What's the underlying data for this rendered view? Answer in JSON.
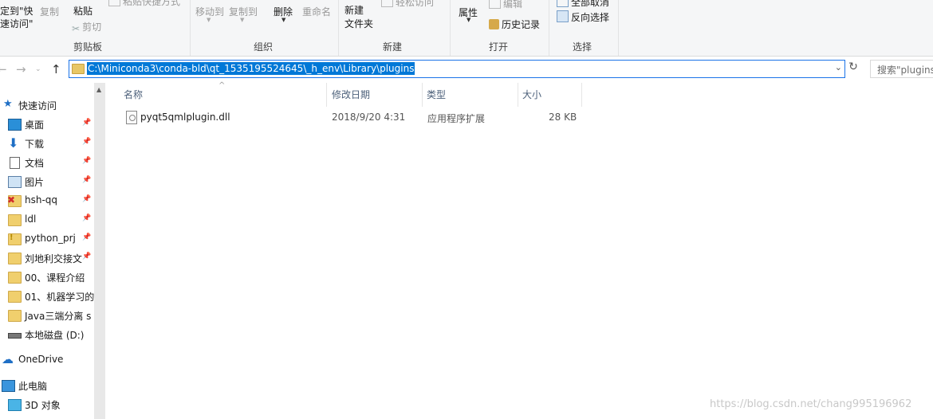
{
  "ribbon": {
    "clipboard": {
      "pin_to_quick_access": "定到\"快\n速访问\"",
      "copy": "复制",
      "paste": "粘贴",
      "cut": "剪切",
      "copy_path_partial": "粘贴快捷方式",
      "group_label": "剪贴板"
    },
    "organize": {
      "move_to": "移动到",
      "copy_to": "复制到",
      "delete": "删除",
      "rename": "重命名",
      "group_label": "组织"
    },
    "new": {
      "new_folder": "新建\n文件夹",
      "easy_access": "轻松访问",
      "group_label": "新建"
    },
    "open": {
      "properties": "属性",
      "edit": "编辑",
      "history": "历史记录",
      "group_label": "打开"
    },
    "select": {
      "select_none_partial": "全部取消",
      "invert_selection": "反向选择",
      "group_label": "选择"
    }
  },
  "address": {
    "path": "C:\\Miniconda3\\conda-bld\\qt_1535195524645\\_h_env\\Library\\plugins",
    "search_placeholder": "搜索\"plugins\""
  },
  "sidebar": {
    "quick_access": "快速访问",
    "items": [
      {
        "label": "桌面",
        "icon": "desktop-icon",
        "pinned": true
      },
      {
        "label": "下载",
        "icon": "download-icon",
        "pinned": true
      },
      {
        "label": "文档",
        "icon": "document-icon",
        "pinned": true
      },
      {
        "label": "图片",
        "icon": "picture-icon",
        "pinned": true
      },
      {
        "label": "hsh-qq",
        "icon": "folder-error-icon",
        "pinned": true
      },
      {
        "label": "ldl",
        "icon": "folder-icon",
        "pinned": true
      },
      {
        "label": "python_prj",
        "icon": "folder-warning-icon",
        "pinned": true
      },
      {
        "label": "刘地利交接文",
        "icon": "folder-icon",
        "pinned": true
      },
      {
        "label": "00、课程介绍",
        "icon": "folder-icon",
        "pinned": false
      },
      {
        "label": "01、机器学习的",
        "icon": "folder-icon",
        "pinned": false
      },
      {
        "label": "Java三端分离 s",
        "icon": "folder-icon",
        "pinned": false
      },
      {
        "label": "本地磁盘 (D:)",
        "icon": "drive-icon",
        "pinned": false
      }
    ],
    "onedrive": "OneDrive",
    "this_pc": "此电脑",
    "objects_3d": "3D 对象"
  },
  "content": {
    "columns": [
      "名称",
      "修改日期",
      "类型",
      "大小"
    ],
    "files": [
      {
        "name": "pyqt5qmlplugin.dll",
        "modified": "2018/9/20 4:31",
        "type": "应用程序扩展",
        "size": "28 KB"
      }
    ]
  },
  "watermark": "https://blog.csdn.net/chang995196962",
  "colors": {
    "accent": "#0078d7",
    "ribbon_bg": "#f5f6f7",
    "folder": "#f0cf6d"
  }
}
